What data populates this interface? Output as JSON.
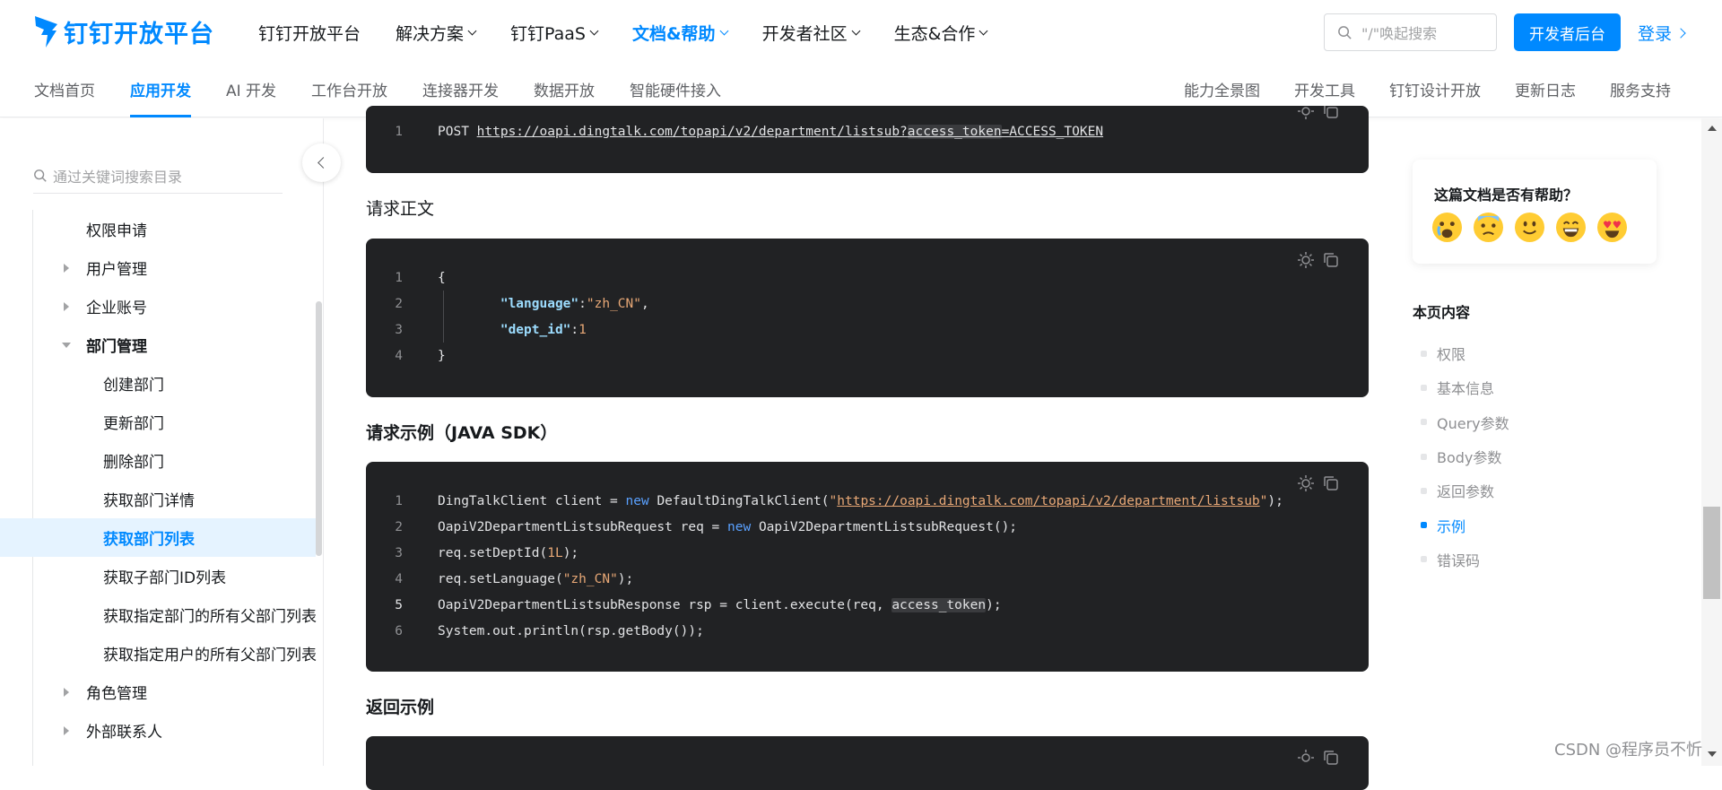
{
  "header": {
    "logo_text": "钉钉开放平台",
    "nav": [
      {
        "label": "钉钉开放平台",
        "dropdown": false,
        "active": false
      },
      {
        "label": "解决方案",
        "dropdown": true,
        "active": false
      },
      {
        "label": "钉钉PaaS",
        "dropdown": true,
        "active": false
      },
      {
        "label": "文档&帮助",
        "dropdown": true,
        "active": true
      },
      {
        "label": "开发者社区",
        "dropdown": true,
        "active": false
      },
      {
        "label": "生态&合作",
        "dropdown": true,
        "active": false
      }
    ],
    "search_placeholder": "\"/\"唤起搜索",
    "dev_button": "开发者后台",
    "login": "登录",
    "accent_color": "#0089ff"
  },
  "subnav": {
    "left": [
      "文档首页",
      "应用开发",
      "AI 开发",
      "工作台开放",
      "连接器开发",
      "数据开放",
      "智能硬件接入"
    ],
    "active": "应用开发",
    "right": [
      "能力全景图",
      "开发工具",
      "钉钉设计开放",
      "更新日志",
      "服务支持"
    ]
  },
  "sidebar": {
    "search_placeholder": "通过关键词搜索目录",
    "items": [
      {
        "label": "权限申请",
        "level": 1,
        "arrow": "none"
      },
      {
        "label": "用户管理",
        "level": 1,
        "arrow": "right"
      },
      {
        "label": "企业账号",
        "level": 1,
        "arrow": "right"
      },
      {
        "label": "部门管理",
        "level": 1,
        "arrow": "down",
        "bold": true
      },
      {
        "label": "创建部门",
        "level": 2
      },
      {
        "label": "更新部门",
        "level": 2
      },
      {
        "label": "删除部门",
        "level": 2
      },
      {
        "label": "获取部门详情",
        "level": 2
      },
      {
        "label": "获取部门列表",
        "level": 2,
        "selected": true
      },
      {
        "label": "获取子部门ID列表",
        "level": 2
      },
      {
        "label": "获取指定部门的所有父部门列表",
        "level": 2
      },
      {
        "label": "获取指定用户的所有父部门列表",
        "level": 2
      },
      {
        "label": "角色管理",
        "level": 1,
        "arrow": "right"
      },
      {
        "label": "外部联系人",
        "level": 1,
        "arrow": "right"
      }
    ]
  },
  "content": {
    "request_line": {
      "method": "POST",
      "url_base": "https://oapi.dingtalk.com/topapi/v2/department/listsub?",
      "param": "access_token",
      "value": "=ACCESS_TOKEN"
    },
    "body_title": "请求正文",
    "body_lines": [
      {
        "n": "1",
        "text": "{"
      },
      {
        "n": "2",
        "key": "\"language\"",
        "sep": ":",
        "val": "\"zh_CN\"",
        "end": ","
      },
      {
        "n": "3",
        "key": "\"dept_id\"",
        "sep": ":",
        "val": "1",
        "end": ""
      },
      {
        "n": "4",
        "text": "}"
      }
    ],
    "sdk_title": "请求示例（JAVA SDK）",
    "sdk_lines": [
      {
        "n": "1"
      },
      {
        "n": "2"
      },
      {
        "n": "3"
      },
      {
        "n": "4"
      },
      {
        "n": "5"
      },
      {
        "n": "6"
      }
    ],
    "sdk_text": {
      "l1a": "DingTalkClient client = ",
      "l1kw": "new",
      "l1b": " DefaultDingTalkClient(",
      "l1q": "\"",
      "l1url": "https://oapi.dingtalk.com/topapi/v2/department/listsub",
      "l1c": ");",
      "l2a": "OapiV2DepartmentListsubRequest req = ",
      "l2kw": "new",
      "l2b": " OapiV2DepartmentListsubRequest();",
      "l3a": "req.setDeptId(",
      "l3n": "1L",
      "l3b": ");",
      "l4a": "req.setLanguage(",
      "l4s": "\"zh_CN\"",
      "l4b": ");",
      "l5a": "OapiV2DepartmentListsubResponse rsp = client.execute(req, ",
      "l5h": "access_token",
      "l5b": ");",
      "l6": "System.out.println(rsp.getBody());"
    },
    "response_title": "返回示例"
  },
  "feedback": {
    "question": "这篇文档是否有帮助？",
    "emojis": [
      "crying-face",
      "anxious-face",
      "slightly-smiling-face",
      "grinning-face",
      "heart-eyes-face"
    ]
  },
  "toc": {
    "title": "本页内容",
    "items": [
      {
        "label": "权限",
        "active": false
      },
      {
        "label": "基本信息",
        "active": false
      },
      {
        "label": "Query参数",
        "active": false
      },
      {
        "label": "Body参数",
        "active": false
      },
      {
        "label": "返回参数",
        "active": false
      },
      {
        "label": "示例",
        "active": true
      },
      {
        "label": "错误码",
        "active": false
      }
    ]
  },
  "watermark": "CSDN @程序员不忻"
}
